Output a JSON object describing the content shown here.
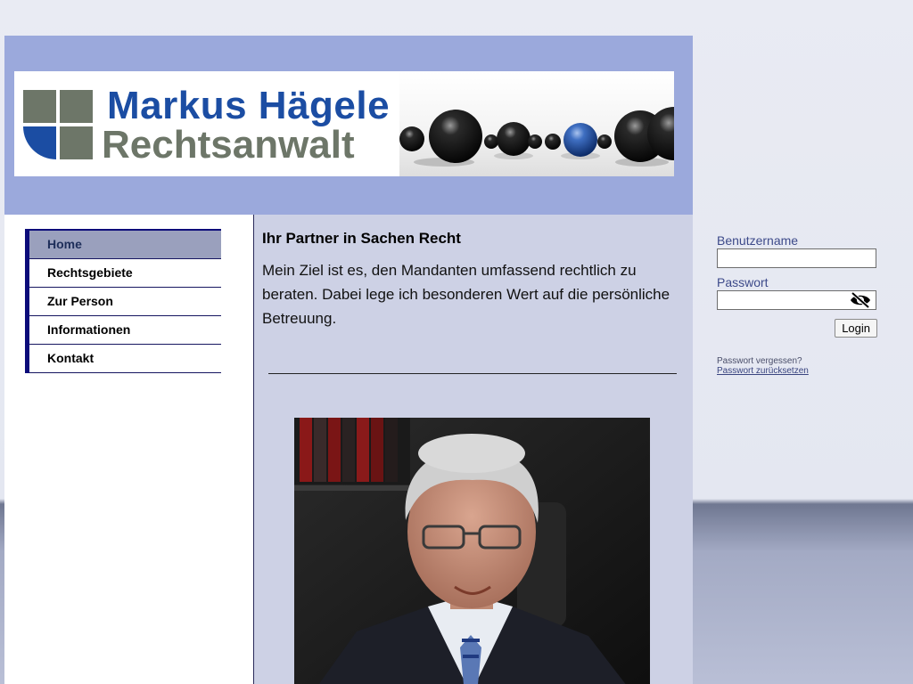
{
  "brand": {
    "name": "Markus Hägele",
    "subtitle": "Rechtsanwalt",
    "colors": {
      "blue": "#1b4da3",
      "gray": "#6d7668",
      "header_bg": "#9ba9dc"
    }
  },
  "nav": {
    "items": [
      {
        "label": "Home",
        "active": true
      },
      {
        "label": "Rechtsgebiete"
      },
      {
        "label": "Zur Person"
      },
      {
        "label": "Informationen"
      },
      {
        "label": "Kontakt"
      }
    ]
  },
  "content": {
    "title": "Ihr Partner in Sachen Recht",
    "text": "Mein Ziel ist es, den Mandanten umfassend rechtlich zu beraten. Dabei lege ich besonderen Wert auf die persönliche Betreuung."
  },
  "login": {
    "username_label": "Benutzername",
    "username_value": "",
    "password_label": "Passwort",
    "password_value": "",
    "password_toggle_icon": "eye-slash-icon",
    "button_label": "Login",
    "forgot_text": "Passwort vergessen?",
    "reset_link": "Passwort zurücksetzen"
  }
}
